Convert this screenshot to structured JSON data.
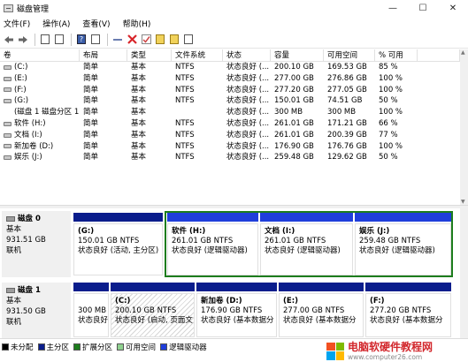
{
  "window": {
    "title": "磁盘管理",
    "min": "—",
    "max": "☐",
    "close": "✕"
  },
  "menu": [
    "文件(F)",
    "操作(A)",
    "查看(V)",
    "帮助(H)"
  ],
  "volume_table": {
    "headers": [
      "卷",
      "布局",
      "类型",
      "文件系统",
      "状态",
      "容量",
      "可用空间",
      "% 可用"
    ],
    "rows": [
      [
        "(C:)",
        "简单",
        "基本",
        "NTFS",
        "状态良好 (...",
        "200.10 GB",
        "169.53 GB",
        "85 %"
      ],
      [
        "(E:)",
        "简单",
        "基本",
        "NTFS",
        "状态良好 (...",
        "277.00 GB",
        "276.86 GB",
        "100 %"
      ],
      [
        "(F:)",
        "简单",
        "基本",
        "NTFS",
        "状态良好 (...",
        "277.20 GB",
        "277.05 GB",
        "100 %"
      ],
      [
        "(G:)",
        "简单",
        "基本",
        "NTFS",
        "状态良好 (...",
        "150.01 GB",
        "74.51 GB",
        "50 %"
      ],
      [
        "(磁盘 1 磁盘分区 1)",
        "简单",
        "基本",
        "",
        "状态良好 (...",
        "300 MB",
        "300 MB",
        "100 %"
      ],
      [
        "软件 (H:)",
        "简单",
        "基本",
        "NTFS",
        "状态良好 (...",
        "261.01 GB",
        "171.21 GB",
        "66 %"
      ],
      [
        "文档 (I:)",
        "简单",
        "基本",
        "NTFS",
        "状态良好 (...",
        "261.01 GB",
        "200.39 GB",
        "77 %"
      ],
      [
        "新加卷 (D:)",
        "简单",
        "基本",
        "NTFS",
        "状态良好 (...",
        "176.90 GB",
        "176.76 GB",
        "100 %"
      ],
      [
        "娱乐 (J:)",
        "简单",
        "基本",
        "NTFS",
        "状态良好 (...",
        "259.48 GB",
        "129.62 GB",
        "50 %"
      ]
    ]
  },
  "disks": [
    {
      "name": "磁盘 0",
      "type": "基本",
      "size": "931.51 GB",
      "status": "联机",
      "partitions": [
        {
          "name": "(G:)",
          "line1": "150.01 GB NTFS",
          "line2": "状态良好 (活动, 主分区)"
        },
        {
          "name": "软件 (H:)",
          "line1": "261.01 GB NTFS",
          "line2": "状态良好 (逻辑驱动器)"
        },
        {
          "name": "文档 (I:)",
          "line1": "261.01 GB NTFS",
          "line2": "状态良好 (逻辑驱动器)"
        },
        {
          "name": "娱乐 (J:)",
          "line1": "259.48 GB NTFS",
          "line2": "状态良好 (逻辑驱动器)"
        }
      ]
    },
    {
      "name": "磁盘 1",
      "type": "基本",
      "size": "931.50 GB",
      "status": "联机",
      "partitions": [
        {
          "name": "",
          "line1": "300 MB",
          "line2": "状态良好"
        },
        {
          "name": "(C:)",
          "line1": "200.10 GB NTFS",
          "line2": "状态良好 (启动, 页面文"
        },
        {
          "name": "新加卷 (D:)",
          "line1": "176.90 GB NTFS",
          "line2": "状态良好 (基本数据分"
        },
        {
          "name": "(E:)",
          "line1": "277.00 GB NTFS",
          "line2": "状态良好 (基本数据分"
        },
        {
          "name": "(F:)",
          "line1": "277.20 GB NTFS",
          "line2": "状态良好 (基本数据分"
        }
      ]
    }
  ],
  "legend": [
    {
      "label": "未分配",
      "color": "#000000"
    },
    {
      "label": "主分区",
      "color": "#0a1d8c"
    },
    {
      "label": "扩展分区",
      "color": "#1d7d1d"
    },
    {
      "label": "可用空间",
      "color": "#8fd18f"
    },
    {
      "label": "逻辑驱动器",
      "color": "#1f3edb"
    }
  ],
  "watermark": {
    "title": "电脑软硬件教程网",
    "url": "www.computer26.com"
  },
  "icons": {
    "toolbar": [
      "back-arrow-icon",
      "forward-arrow-icon",
      "console-tree-icon",
      "volume-list-icon",
      "help-icon",
      "properties-icon",
      "connect-icon",
      "delete-icon",
      "check-icon",
      "import-icon",
      "export-icon"
    ]
  }
}
